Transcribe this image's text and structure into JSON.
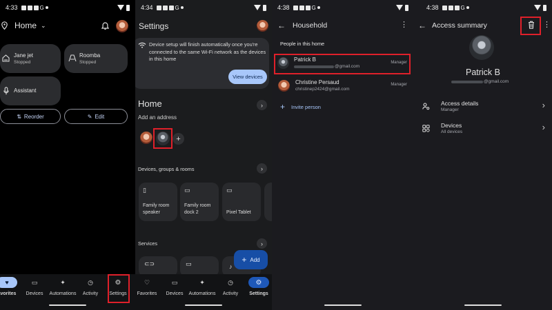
{
  "colors": {
    "accent": "#a8c7fa",
    "highlight": "#e0202a",
    "fab": "#174ea6"
  },
  "panel1": {
    "status_time": "4:33",
    "home_title": "Home",
    "devices": [
      {
        "name": "Jane jet",
        "status": "Stopped",
        "icon": "vacuum-icon"
      },
      {
        "name": "Roomba",
        "status": "Stopped",
        "icon": "vacuum-icon"
      },
      {
        "name": "Assistant",
        "status": "",
        "icon": "mic-icon"
      }
    ],
    "reorder_label": "Reorder",
    "edit_label": "Edit",
    "nav": [
      "Favorites",
      "Devices",
      "Automations",
      "Activity",
      "Settings"
    ],
    "nav_first_visible": "avorites"
  },
  "panel2": {
    "status_time": "4:34",
    "title": "Settings",
    "banner_text": "Device setup will finish automatically once you're connected to the same Wi-Fi network as the devices in this home",
    "view_devices": "View devices",
    "home_name": "Home",
    "add_address": "Add an address",
    "devices_section": "Devices, groups & rooms",
    "device_cards": [
      {
        "label": "Family room speaker",
        "icon": "speaker-icon"
      },
      {
        "label": "Family room dock 2",
        "icon": "dock-icon"
      },
      {
        "label": "Pixel Tablet",
        "icon": "tablet-icon"
      }
    ],
    "services_section": "Services",
    "add_label": "Add",
    "nav": [
      "Favorites",
      "Devices",
      "Automations",
      "Activity",
      "Settings"
    ]
  },
  "panel3": {
    "status_time": "4:38",
    "title": "Household",
    "section": "People in this home",
    "people": [
      {
        "name": "Patrick B",
        "email": "@gmail.com",
        "role": "Manager"
      },
      {
        "name": "Christine Persaud",
        "email": "christinep2424@gmail.com",
        "role": "Manager"
      }
    ],
    "invite": "Invite person"
  },
  "panel4": {
    "status_time": "4:38",
    "title": "Access summary",
    "name": "Patrick B",
    "email": "@gmail.com",
    "rows": [
      {
        "title": "Access details",
        "sub": "Manager",
        "icon": "person-settings-icon"
      },
      {
        "title": "Devices",
        "sub": "All devices",
        "icon": "devices-grid-icon"
      }
    ]
  }
}
